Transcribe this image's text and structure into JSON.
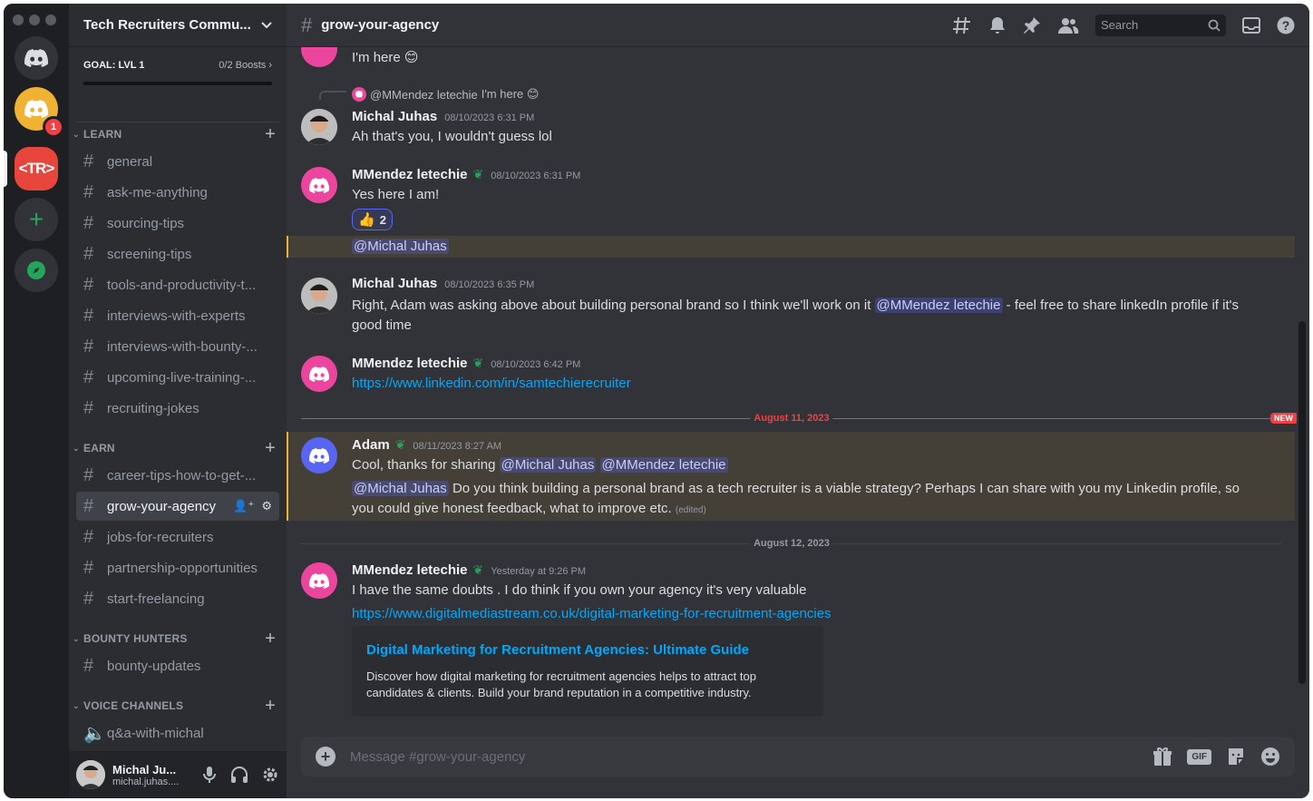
{
  "window": {
    "traffic_lights": [
      "close",
      "minimize",
      "zoom"
    ]
  },
  "rail": {
    "servers": [
      {
        "name": "Direct Messages",
        "icon": "discord-logo-icon"
      },
      {
        "name": "Tech Recruiters Community",
        "badge": "1"
      },
      {
        "name": "TR",
        "label": "<TR>"
      },
      {
        "name": "Add a Server",
        "label": "+"
      },
      {
        "name": "Explore",
        "icon": "compass-icon"
      }
    ]
  },
  "sidebar": {
    "guild_name": "Tech Recruiters Commu...",
    "goal_label": "GOAL: LVL 1",
    "goal_value": "0/2 Boosts",
    "goal_progress": 0,
    "categories": {
      "learn": "LEARN",
      "earn": "EARN",
      "bounty": "BOUNTY HUNTERS",
      "voice": "VOICE CHANNELS"
    },
    "learn_channels": [
      "general",
      "ask-me-anything",
      "sourcing-tips",
      "screening-tips",
      "tools-and-productivity-t...",
      "interviews-with-experts",
      "interviews-with-bounty-...",
      "upcoming-live-training-...",
      "recruiting-jokes"
    ],
    "earn_channels": [
      "career-tips-how-to-get-...",
      "grow-your-agency",
      "jobs-for-recruiters",
      "partnership-opportunities",
      "start-freelancing"
    ],
    "bounty_channels": [
      "bounty-updates"
    ],
    "voice_channels": [
      "q&a-with-michal"
    ],
    "user": {
      "name": "Michal Ju...",
      "sub": "michal.juhas...."
    }
  },
  "topbar": {
    "channel": "grow-your-agency",
    "search_placeholder": "Search"
  },
  "messages": {
    "m0": {
      "text": "I'm here 😊"
    },
    "m1": {
      "reply_author": "@MMendez letechie",
      "reply_text": "I'm here 😊",
      "author": "Michal Juhas",
      "time": "08/10/2023 6:31 PM",
      "text": "Ah that's you, I wouldn't guess lol"
    },
    "m2": {
      "author": "MMendez letechie",
      "time": "08/10/2023 6:31 PM",
      "text": "Yes here I am!",
      "reaction_emoji": "👍",
      "reaction_count": "2",
      "mention_line": "@Michal Juhas"
    },
    "m3": {
      "author": "Michal Juhas",
      "time": "08/10/2023 6:35 PM",
      "text_a": "Right, Adam was asking above about building personal brand so I think we'll work on it",
      "mention": "@MMendez letechie",
      "text_b": "- feel free to share linkedIn profile if it's good time"
    },
    "m4": {
      "author": "MMendez letechie",
      "time": "08/10/2023 6:42 PM",
      "link": "https://www.linkedin.com/in/samtechierecruiter"
    },
    "divider1": {
      "label": "August 11, 2023",
      "tag": "NEW"
    },
    "m5": {
      "author": "Adam",
      "time": "08/11/2023 8:27 AM",
      "text_a": "Cool, thanks for sharing",
      "mention_a": "@Michal Juhas",
      "mention_b": "@MMendez letechie",
      "mention_c": "@Michal Juhas",
      "text_b": "Do you think building a personal brand as a tech recruiter is a viable strategy? Perhaps I can share with you my Linkedin profile, so you could give honest feedback, what to improve etc.",
      "edited": "(edited)"
    },
    "divider2": {
      "label": "August 12, 2023"
    },
    "m6": {
      "author": "MMendez letechie",
      "time": "Yesterday at 9:26 PM",
      "text": "I have the same doubts . I do think if you own your agency it's very valuable",
      "link": "https://www.digitalmediastream.co.uk/digital-marketing-for-recruitment-agencies",
      "embed_title": "Digital Marketing for Recruitment Agencies: Ultimate Guide",
      "embed_desc": "Discover how digital marketing for recruitment agencies helps to attract top candidates & clients. Build your brand reputation in a competitive industry."
    }
  },
  "composer": {
    "placeholder": "Message #grow-your-agency",
    "gif": "GIF"
  },
  "colors": {
    "accent": "#5865f2",
    "mention_bg": "#3c4270",
    "new": "#f23f43",
    "link": "#00a8fc"
  }
}
